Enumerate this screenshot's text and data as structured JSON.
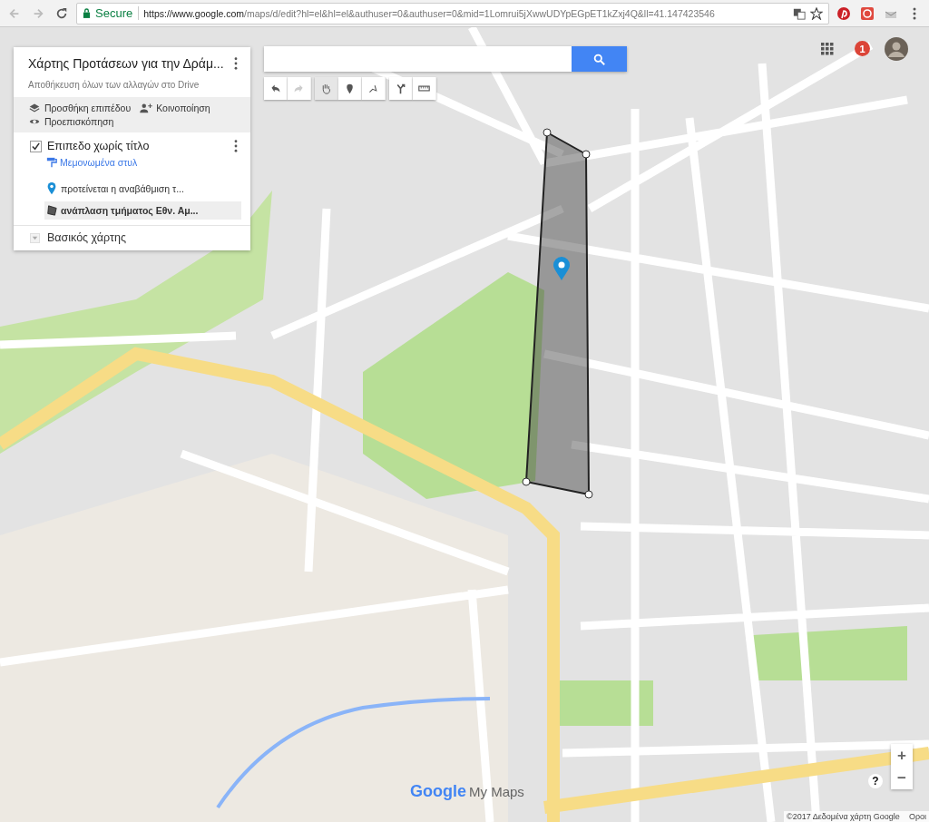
{
  "browser": {
    "secure_label": "Secure",
    "url_host": "https://www.google.com",
    "url_path": "/maps/d/edit?hl=el&hl=el&authuser=0&authuser=0&mid=1Lomrui5jXwwUDYpEGpET1kZxj4Q&ll=41.147423546"
  },
  "account": {
    "notification_count": "1"
  },
  "panel": {
    "title": "Χάρτης Προτάσεων για την Δράμ...",
    "subtitle": "Αποθήκευση όλων των αλλαγών στο Drive",
    "actions": [
      {
        "kind": "layers",
        "label": "Προσθήκη επιπέδου"
      },
      {
        "kind": "share",
        "label": "Κοινοποίηση"
      },
      {
        "kind": "preview",
        "label": "Προεπισκόπηση"
      }
    ],
    "layer": {
      "name": "Επιπεδο χωρίς τίτλο",
      "checked": true,
      "style_link": "Μεμονωμένα στυλ",
      "features": [
        {
          "kind": "marker",
          "label": "προτείνεται η αναβάθμιση τ...",
          "selected": false
        },
        {
          "kind": "polygon",
          "label": "ανάπλαση τμήματος Εθν. Αμ...",
          "selected": true
        }
      ]
    },
    "base_map": {
      "label": "Βασικός χάρτης",
      "expanded": false
    }
  },
  "tools": [
    {
      "kind": "undo",
      "selected": false,
      "disabled": false
    },
    {
      "kind": "redo",
      "selected": false,
      "disabled": true
    },
    {
      "kind": "hand",
      "selected": true,
      "disabled": false
    },
    {
      "kind": "marker",
      "selected": false,
      "disabled": false
    },
    {
      "kind": "line",
      "selected": false,
      "disabled": false
    },
    {
      "kind": "directions",
      "selected": false,
      "disabled": false
    },
    {
      "kind": "ruler",
      "selected": false,
      "disabled": false
    }
  ],
  "zoom": {
    "in": "+",
    "out": "−"
  },
  "help": "?",
  "logo": {
    "brand": "Google",
    "product": "My Maps"
  },
  "attribution": "©2017 Δεδομένα χάρτη Google",
  "terms": "Οροι"
}
